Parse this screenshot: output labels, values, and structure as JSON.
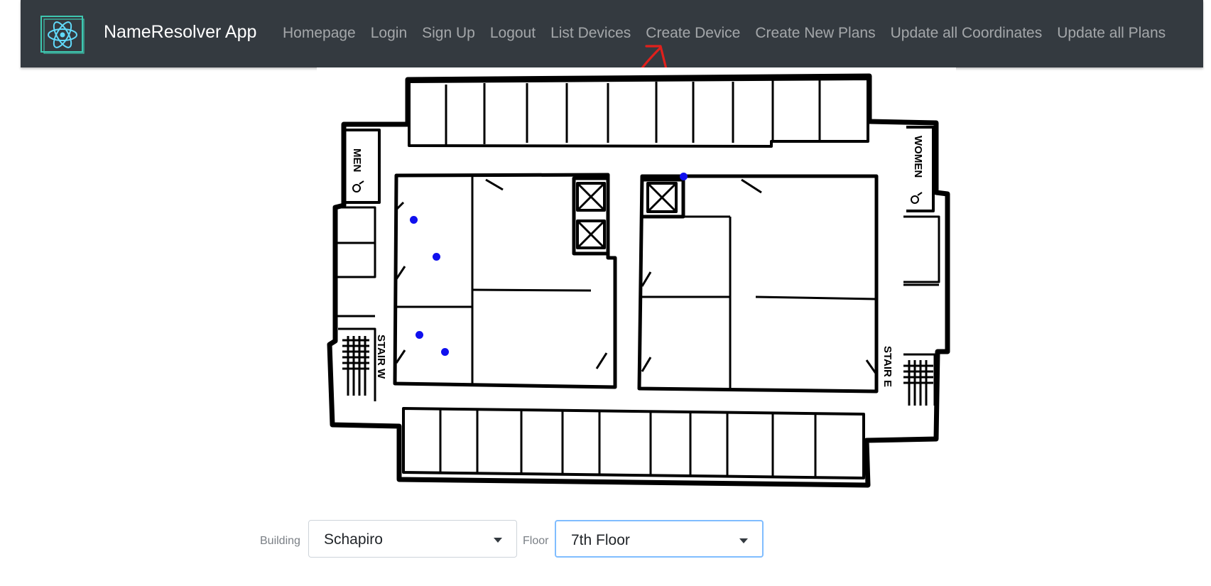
{
  "app": {
    "brand": "NameResolver App",
    "logo_icon": "react-atom-logo-icon",
    "accent": "#61dafb"
  },
  "nav": {
    "links": [
      {
        "label": "Homepage"
      },
      {
        "label": "Login"
      },
      {
        "label": "Sign Up"
      },
      {
        "label": "Logout"
      },
      {
        "label": "List Devices"
      },
      {
        "label": "Create Device"
      },
      {
        "label": "Create New Plans"
      },
      {
        "label": "Update all Coordinates"
      },
      {
        "label": "Update all Plans"
      }
    ]
  },
  "annotation": {
    "icon": "red-arrow-annotation-icon",
    "color": "#e0201c"
  },
  "floor_plan": {
    "room_labels": {
      "men": "MEN",
      "women": "WOMEN",
      "stair_w": "STAIR W",
      "stair_e": "STAIR E"
    },
    "device_marker_color": "#1010ee",
    "device_marker_count": 5
  },
  "form": {
    "building_label": "Building",
    "building_value": "Schapiro",
    "floor_label": "Floor",
    "floor_value": "7th Floor"
  }
}
